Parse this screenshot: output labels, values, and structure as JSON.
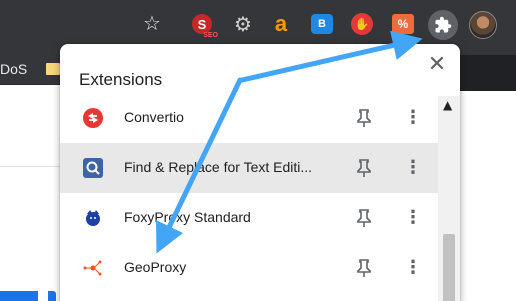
{
  "toolbar": {
    "bookmark_star_icon": "star-outline-icon",
    "extensions": [
      {
        "name": "seo-extension-icon",
        "text": "S",
        "sub": "SEO",
        "color": "#c62828"
      },
      {
        "name": "gear-extension-icon",
        "text": "⚙",
        "color": "#cfcfcf"
      },
      {
        "name": "amazon-extension-icon",
        "text": "a",
        "color": "#ff9900"
      },
      {
        "name": "b-extension-icon",
        "text": "B",
        "color": "#1e88e5"
      },
      {
        "name": "hand-extension-icon",
        "text": "✋",
        "color": "#e53935"
      },
      {
        "name": "percent-extension-icon",
        "text": "%",
        "color": "#ef6c3a"
      }
    ],
    "puzzle_icon": "puzzle-icon",
    "avatar": "profile-avatar"
  },
  "bookmarks": {
    "item_label": "DoS"
  },
  "popup": {
    "title": "Extensions",
    "close_symbol": "✕",
    "scroll_up_symbol": "▲",
    "items": [
      {
        "label": "Convertio",
        "icon": "convertio-icon",
        "color": "#e53935",
        "pinned": false
      },
      {
        "label": "Find & Replace for Text Editi...",
        "icon": "find-replace-icon",
        "color": "#3f63a6",
        "pinned": false,
        "hovered": true
      },
      {
        "label": "FoxyProxy Standard",
        "icon": "foxyproxy-icon",
        "color": "#1e3fa6",
        "pinned": false
      },
      {
        "label": "GeoProxy",
        "icon": "geoproxy-icon",
        "color": "#f4511e",
        "pinned": false
      }
    ],
    "more_symbol": "⋮"
  },
  "annotation": {
    "arrow_color": "#42a5f5"
  }
}
